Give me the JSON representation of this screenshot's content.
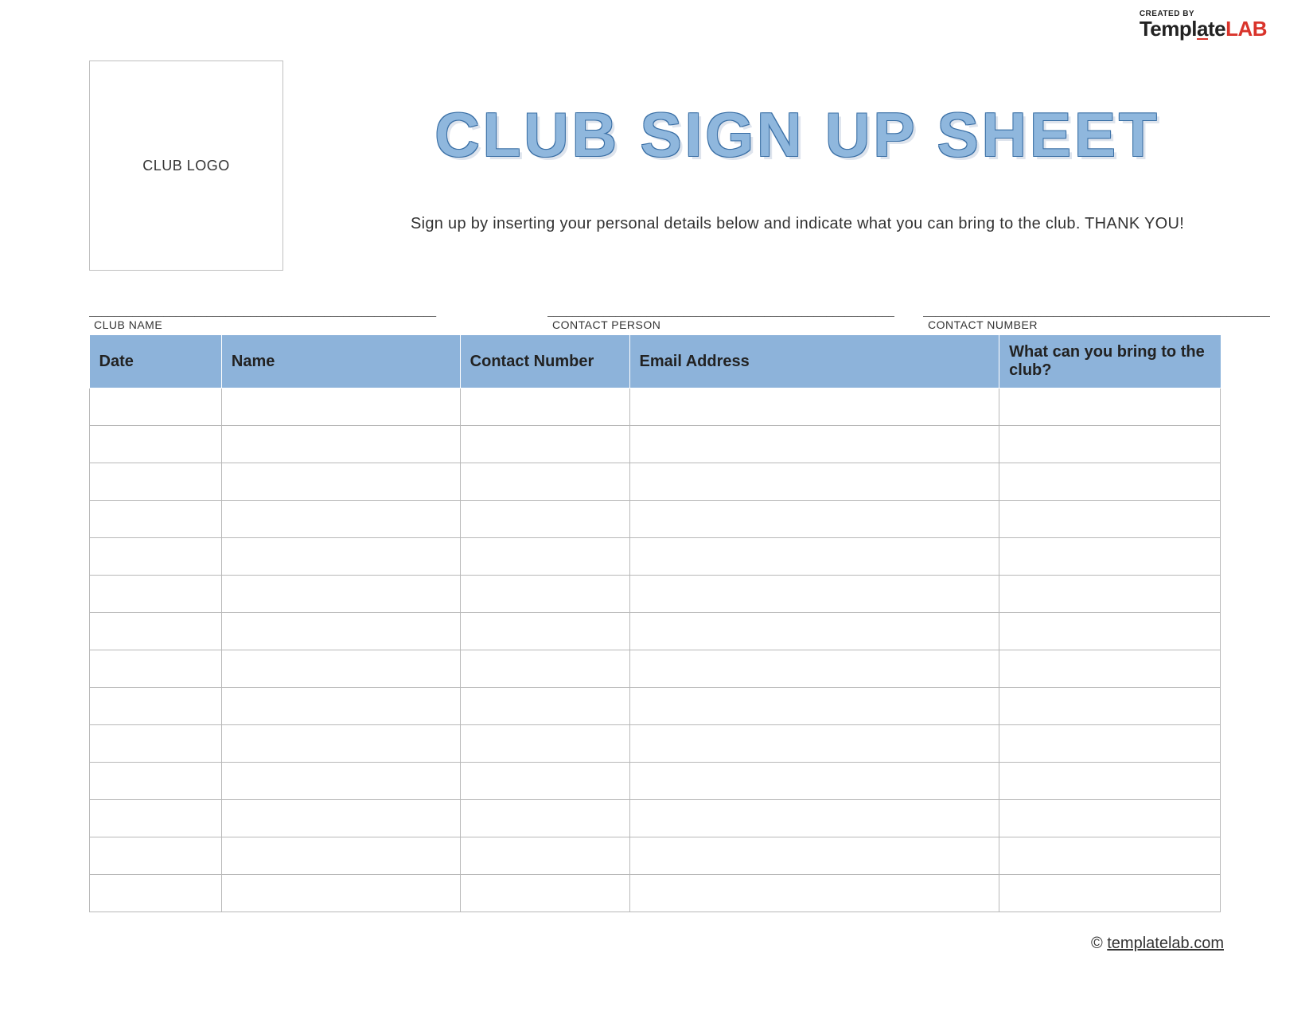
{
  "brand": {
    "created_by": "CREATED BY",
    "name_part1": "Templ",
    "name_part2": "a",
    "name_part3": "te",
    "name_lab": "LAB"
  },
  "header": {
    "logo_placeholder": "CLUB LOGO",
    "title": "CLUB SIGN UP SHEET",
    "subtitle": "Sign up by inserting your personal details below and indicate what you can bring to the club. THANK YOU!"
  },
  "info_fields": {
    "line": "________________________________________________________",
    "club_name_label": "CLUB NAME",
    "contact_person_label": "CONTACT PERSON",
    "contact_number_label": "CONTACT NUMBER"
  },
  "table": {
    "headers": {
      "date": "Date",
      "name": "Name",
      "contact": "Contact Number",
      "email": "Email Address",
      "bring": "What can you bring to the club?"
    },
    "row_count": 14
  },
  "footer": {
    "copyright": "©",
    "link_text": "templatelab.com"
  }
}
